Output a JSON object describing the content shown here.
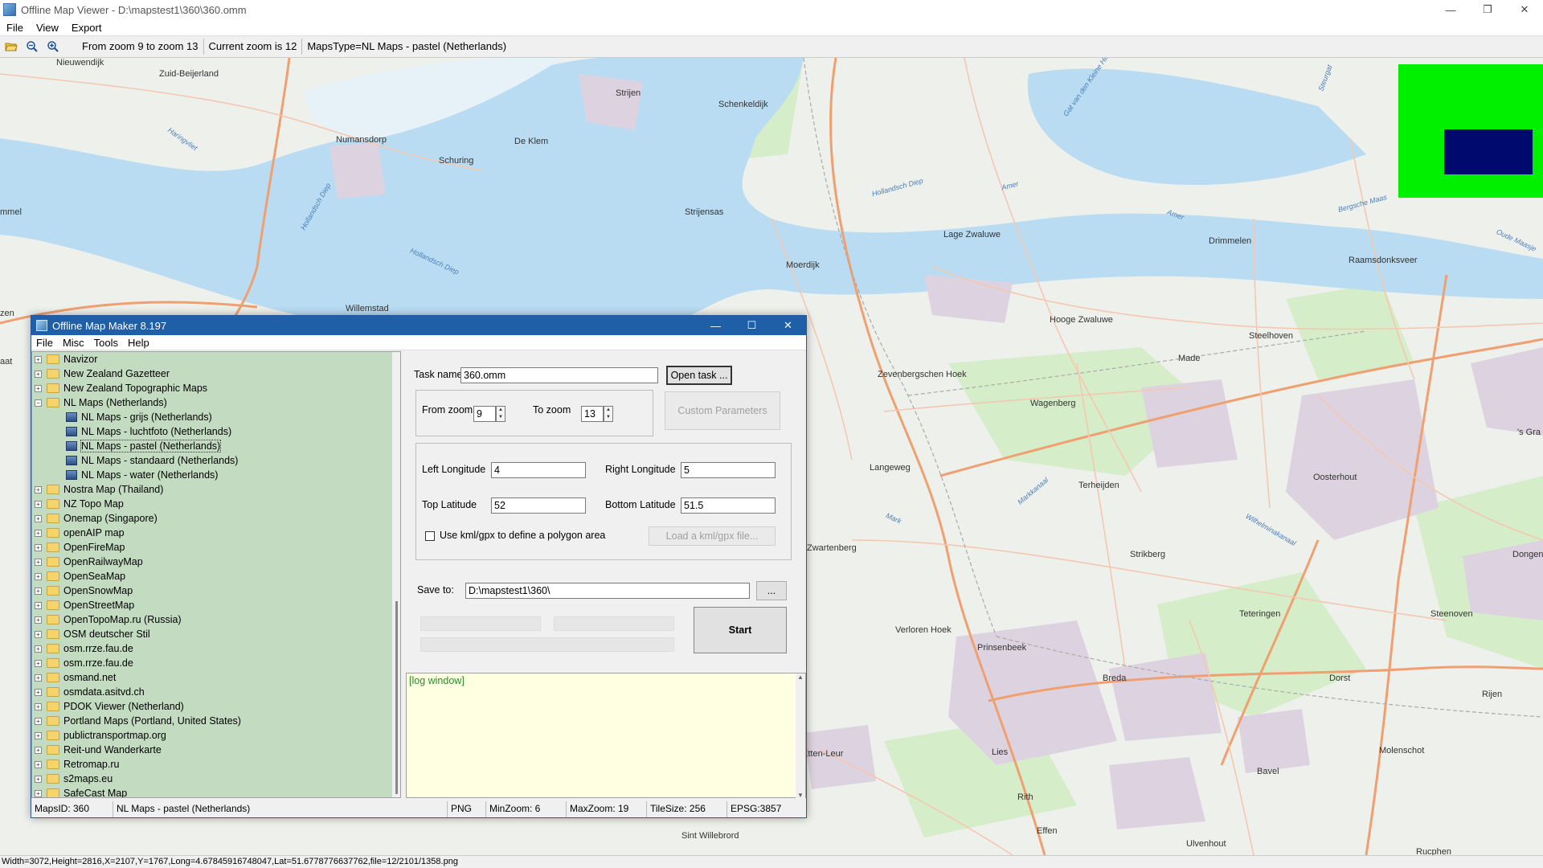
{
  "window": {
    "title": "Offline Map Viewer - D:\\mapstest1\\360\\360.omm",
    "controls": [
      "—",
      "❐",
      "✕"
    ]
  },
  "menu": [
    "File",
    "View",
    "Export"
  ],
  "toolbar": {
    "icons": [
      "open-folder-icon",
      "zoom-out-icon",
      "zoom-in-icon"
    ],
    "zoom_range": "From zoom 9 to zoom 13",
    "current_zoom": "Current zoom is 12",
    "maps_type": "MapsType=NL Maps - pastel (Netherlands)"
  },
  "map": {
    "labels": [
      "Nieuwendijk",
      "Zuid-Beijerland",
      "Strijen",
      "Schenkeldijk",
      "Numansdorp",
      "De Klem",
      "Schuring",
      "Strijensas",
      "Lage Zwaluwe",
      "Drimmelen",
      "Raamsdonksveer",
      "Moerdijk",
      "Willemstad",
      "Hooge Zwaluwe",
      "Steelhoven",
      "Made",
      "Zevenbergschen Hoek",
      "Wagenberg",
      "Langeweg",
      "Terheijden",
      "Oosterhout",
      "Zwartenberg",
      "Strikberg",
      "Dongen",
      "Teteringen",
      "Steenoven",
      "Verloren Hoek",
      "Prinsenbeek",
      "Breda",
      "Dorst",
      "Rijen",
      "Etten-Leur",
      "Lies",
      "Molenschot",
      "Bavel",
      "Rith",
      "Effen",
      "Sint Willebrord",
      "Ulvenhout",
      "Rucphen",
      "'s Gra",
      "mmel",
      "zen",
      "aat"
    ],
    "water_labels": [
      "Haringvliet",
      "Hollandsch Diep",
      "Hollandsch Diep",
      "Hollandsch Diep",
      "Amer",
      "Amer",
      "Bergsche Maas",
      "Oude Maasje",
      "Mark",
      "Markkanaal",
      "Wilhelminakanaal",
      "Gat van den Kleine Hil",
      "Steurgat"
    ]
  },
  "status_bar": "Width=3072,Height=2816,X=2107,Y=1767,Long=4.67845916748047,Lat=51.6778776637762,file=12/2101/1358.png",
  "dialog": {
    "title": "Offline Map Maker 8.197",
    "controls": [
      "—",
      "☐",
      "✕"
    ],
    "menu": [
      "File",
      "Misc",
      "Tools",
      "Help"
    ],
    "tree": [
      {
        "label": "Navizor",
        "type": "folder",
        "expanded": false
      },
      {
        "label": "New Zealand Gazetteer",
        "type": "folder",
        "expanded": false
      },
      {
        "label": "New Zealand Topographic Maps",
        "type": "folder",
        "expanded": false
      },
      {
        "label": "NL Maps (Netherlands)",
        "type": "folder",
        "expanded": true
      },
      {
        "label": "NL Maps - grijs (Netherlands)",
        "type": "map",
        "expanded": false
      },
      {
        "label": "NL Maps - luchtfoto (Netherlands)",
        "type": "map",
        "expanded": false
      },
      {
        "label": "NL Maps - pastel (Netherlands)",
        "type": "map",
        "selected": true
      },
      {
        "label": "NL Maps - standaard (Netherlands)",
        "type": "map",
        "expanded": false
      },
      {
        "label": "NL Maps - water (Netherlands)",
        "type": "map",
        "expanded": false
      },
      {
        "label": "Nostra Map (Thailand)",
        "type": "folder",
        "expanded": false
      },
      {
        "label": "NZ Topo Map",
        "type": "folder",
        "expanded": false
      },
      {
        "label": "Onemap (Singapore)",
        "type": "folder",
        "expanded": false
      },
      {
        "label": "openAIP map",
        "type": "folder",
        "expanded": false
      },
      {
        "label": "OpenFireMap",
        "type": "folder",
        "expanded": false
      },
      {
        "label": "OpenRailwayMap",
        "type": "folder",
        "expanded": false
      },
      {
        "label": "OpenSeaMap",
        "type": "folder",
        "expanded": false
      },
      {
        "label": "OpenSnowMap",
        "type": "folder",
        "expanded": false
      },
      {
        "label": "OpenStreetMap",
        "type": "folder",
        "expanded": false
      },
      {
        "label": "OpenTopoMap.ru (Russia)",
        "type": "folder",
        "expanded": false
      },
      {
        "label": "OSM deutscher Stil",
        "type": "folder",
        "expanded": false
      },
      {
        "label": "osm.rrze.fau.de",
        "type": "folder",
        "expanded": false
      },
      {
        "label": "osm.rrze.fau.de",
        "type": "folder",
        "expanded": false
      },
      {
        "label": "osmand.net",
        "type": "folder",
        "expanded": false
      },
      {
        "label": "osmdata.asitvd.ch",
        "type": "folder",
        "expanded": false
      },
      {
        "label": "PDOK Viewer (Netherland)",
        "type": "folder",
        "expanded": false
      },
      {
        "label": "Portland Maps (Portland, United States)",
        "type": "folder",
        "expanded": false
      },
      {
        "label": "publictransportmap.org",
        "type": "folder",
        "expanded": false
      },
      {
        "label": "Reit-und Wanderkarte",
        "type": "folder",
        "expanded": false
      },
      {
        "label": "Retromap.ru",
        "type": "folder",
        "expanded": false
      },
      {
        "label": "s2maps.eu",
        "type": "folder",
        "expanded": false
      },
      {
        "label": "SafeCast Map",
        "type": "folder",
        "expanded": false
      }
    ],
    "form": {
      "task_name_label": "Task name",
      "task_name_value": "360.omm",
      "open_task_label": "Open task ...",
      "from_zoom_label": "From zoom",
      "from_zoom_value": "9",
      "to_zoom_label": "To zoom",
      "to_zoom_value": "13",
      "custom_params_label": "Custom Parameters",
      "left_lon_label": "Left Longitude",
      "left_lon_value": "4",
      "right_lon_label": "Right Longitude",
      "right_lon_value": "5",
      "top_lat_label": "Top Latitude",
      "top_lat_value": "52",
      "bottom_lat_label": "Bottom Latitude",
      "bottom_lat_value": "51.5",
      "kml_checkbox_label": "Use kml/gpx to define a polygon area",
      "kml_checked": false,
      "load_kml_label": "Load a kml/gpx file...",
      "save_to_label": "Save to:",
      "save_to_value": "D:\\mapstest1\\360\\",
      "browse_label": "...",
      "start_label": "Start"
    },
    "log_text": "[log window]",
    "status": {
      "maps_id": "MapsID: 360",
      "map_name": "NL Maps - pastel (Netherlands)",
      "format": "PNG",
      "min_zoom": "MinZoom: 6",
      "max_zoom": "MaxZoom: 19",
      "tile_size": "TileSize: 256",
      "epsg": "EPSG:3857"
    }
  },
  "colors": {
    "dialog_title_bg": "#1e5fa8",
    "tree_bg": "#c3dcc1",
    "log_bg": "#ffffe1",
    "minimap_bg": "#00f000",
    "minimap_view": "#000a6e",
    "water": "#b9dcf2",
    "urban": "#ddd3e0",
    "road_major": "#f0a070",
    "road_minor": "#f4c8b0"
  }
}
